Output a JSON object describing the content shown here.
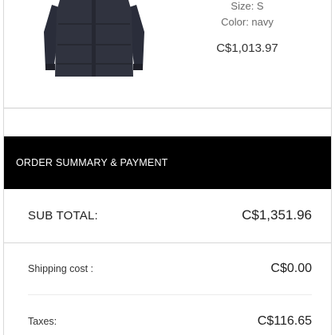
{
  "product": {
    "image_name": "navy-parka-jacket",
    "size_text": "Size: S",
    "color_text": "Color: navy",
    "price": "C$1,013.97",
    "jacket_color": "#2e3140"
  },
  "summary": {
    "title": "ORDER SUMMARY & PAYMENT",
    "subtotal_label": "SUB TOTAL:",
    "subtotal_value": "C$1,351.96",
    "shipping_label": "Shipping cost :",
    "shipping_value": "C$0.00",
    "taxes_label": "Taxes:",
    "taxes_value": "C$116.65"
  }
}
